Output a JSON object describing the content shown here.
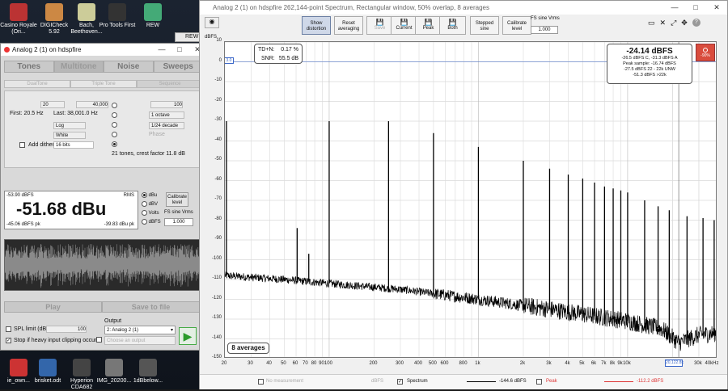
{
  "desktop": {
    "icons": [
      {
        "label": "Casino Royale (Ori...",
        "color": "#b33"
      },
      {
        "label": "DIGICheck 5.92",
        "color": "#c84"
      },
      {
        "label": "Bach, Beethoven...",
        "color": "#cc9"
      },
      {
        "label": "Pro Tools First",
        "color": "#333"
      },
      {
        "label": "REW",
        "color": "#4a7"
      }
    ],
    "bottom_icons": [
      {
        "label": "ie_own...",
        "color": "#c33"
      },
      {
        "label": "brisket.odt",
        "color": "#36a"
      },
      {
        "label": "Hyperion CDA682",
        "color": "#444"
      },
      {
        "label": "IMG_20200...",
        "color": "#777"
      },
      {
        "label": "1dBbelow...",
        "color": "#555"
      }
    ],
    "rew_tab": "REW"
  },
  "generator": {
    "title": "Analog 2 (1) on hdspfire",
    "tabs": [
      "Tones",
      "Multitone",
      "Noise",
      "Sweeps"
    ],
    "subtabs": [
      "DualTone",
      "Triple Tone",
      "Sequence"
    ],
    "first_hz": "First: 20.5 Hz",
    "last_hz": "Last: 38,001.0 Hz",
    "field_20": "20",
    "field_40000": "40,000",
    "field_100": "100",
    "octave": "1 octave",
    "decade": "1/24 decade",
    "log": "Log",
    "white": "White",
    "phase": "Phase",
    "add_dither": "Add dither",
    "bits": "16 bits",
    "tones_info": "21 tones, crest factor 11.8 dB",
    "meter": {
      "top_left": "-53.90 dBFS",
      "rms": "RMS",
      "value": "-51.68 dBu",
      "bottom_left": "-45.06 dBFS pk",
      "bottom_right": "-39.83 dBu pk",
      "units": [
        "dBu",
        "dBV",
        "Volts",
        "dBFS"
      ],
      "selected_unit": 0,
      "calibrate": "Calibrate level",
      "fs_sine_label": "FS sine Vrms",
      "fs_sine_value": "1.000"
    },
    "play": "Play",
    "save": "Save to file",
    "spl_limit": "SPL limit (dB):",
    "spl_value": "100",
    "stop_clip": "Stop if heavy input clipping occurs",
    "output_label": "Output",
    "output_value": "2: Analog 2 (1)",
    "choose_output": "Choose an output"
  },
  "analyzer": {
    "title": "Analog 2 (1) on hdspfire 262,144-point Spectrum, Rectangular window, 50% overlap, 8 averages",
    "toolbar": [
      {
        "label": "Show distortion",
        "glyph": "",
        "state": "active"
      },
      {
        "label": "Reset averaging",
        "glyph": "",
        "state": "normal"
      },
      {
        "label": "Save",
        "glyph": "💾",
        "state": "disabled"
      },
      {
        "label": "Current",
        "glyph": "💾",
        "state": "normal"
      },
      {
        "label": "Peak",
        "glyph": "💾",
        "state": "normal"
      },
      {
        "label": "Both",
        "glyph": "💾",
        "state": "normal"
      },
      {
        "label": "Stepped sine",
        "glyph": "",
        "state": "normal"
      },
      {
        "label": "Calibrate level",
        "glyph": "",
        "state": "normal"
      }
    ],
    "fs_sine_label": "FS sine Vrms",
    "fs_sine_value": "1.000",
    "yunit": "dBFS",
    "y_marker": "3.0",
    "x_cursor": "20,122.8k",
    "thd": {
      "tdn_label": "TD+N:",
      "tdn_value": "0.17 %",
      "snr_label": "SNR:",
      "snr_value": "55.5 dB"
    },
    "readout": {
      "main": "-24.14 dBFS",
      "lines": [
        "-26.5 dBFS C, -31.3 dBFS A",
        "Peak sample: -16.74 dBFS",
        "-27.5 dBFS 22 - 22k UNW",
        "-51.3 dBFS >22k"
      ]
    },
    "averages": "8 averages",
    "level_indicator": "-90%",
    "legend": {
      "no_meas": "No measurement",
      "unit1": "dBFS",
      "spectrum": "Spectrum",
      "spectrum_val": "-144.6 dBFS",
      "peak": "Peak",
      "peak_val": "-112.2 dBFS"
    }
  },
  "chart_data": {
    "type": "line",
    "title": "",
    "xlabel": "",
    "ylabel": "dBFS",
    "x_scale": "log",
    "xlim": [
      20,
      40000
    ],
    "ylim": [
      -150,
      10
    ],
    "x_ticks": [
      "20",
      "30",
      "40",
      "50",
      "60",
      "70",
      "80",
      "90",
      "100",
      "200",
      "300",
      "400",
      "500",
      "600",
      "800",
      "1k",
      "2k",
      "3k",
      "4k",
      "5k",
      "6k",
      "7k",
      "8k",
      "9k",
      "10k",
      "20k",
      "30k",
      "40kHz"
    ],
    "y_ticks": [
      10,
      0,
      -10,
      -20,
      -30,
      -40,
      -50,
      -60,
      -70,
      -80,
      -90,
      -100,
      -110,
      -120,
      -130,
      -140,
      -150
    ],
    "grid": true,
    "series": [
      {
        "name": "Spectrum",
        "tones": [
          {
            "x": 20.5,
            "y": -30
          },
          {
            "x": 61,
            "y": -84
          },
          {
            "x": 73,
            "y": -97
          },
          {
            "x": 100,
            "y": -30
          },
          {
            "x": 250,
            "y": -30
          },
          {
            "x": 500,
            "y": -36
          },
          {
            "x": 1000,
            "y": -43
          },
          {
            "x": 2000,
            "y": -50
          },
          {
            "x": 3000,
            "y": -54
          },
          {
            "x": 4000,
            "y": -57
          },
          {
            "x": 5000,
            "y": -59
          },
          {
            "x": 6000,
            "y": -61
          },
          {
            "x": 7000,
            "y": -63
          },
          {
            "x": 8000,
            "y": -64
          },
          {
            "x": 9000,
            "y": -65
          },
          {
            "x": 10000,
            "y": -66
          },
          {
            "x": 13000,
            "y": -70
          },
          {
            "x": 16000,
            "y": -73
          },
          {
            "x": 19000,
            "y": -75
          },
          {
            "x": 25000,
            "y": -78
          },
          {
            "x": 32000,
            "y": -79
          },
          {
            "x": 38000,
            "y": -80
          }
        ],
        "noise_floor": [
          {
            "x": 20,
            "y": -108
          },
          {
            "x": 50,
            "y": -110
          },
          {
            "x": 100,
            "y": -112
          },
          {
            "x": 300,
            "y": -115
          },
          {
            "x": 1000,
            "y": -120
          },
          {
            "x": 3000,
            "y": -125
          },
          {
            "x": 10000,
            "y": -131
          },
          {
            "x": 17000,
            "y": -135
          },
          {
            "x": 22000,
            "y": -142
          },
          {
            "x": 30000,
            "y": -138
          },
          {
            "x": 40000,
            "y": -137
          }
        ]
      }
    ]
  }
}
